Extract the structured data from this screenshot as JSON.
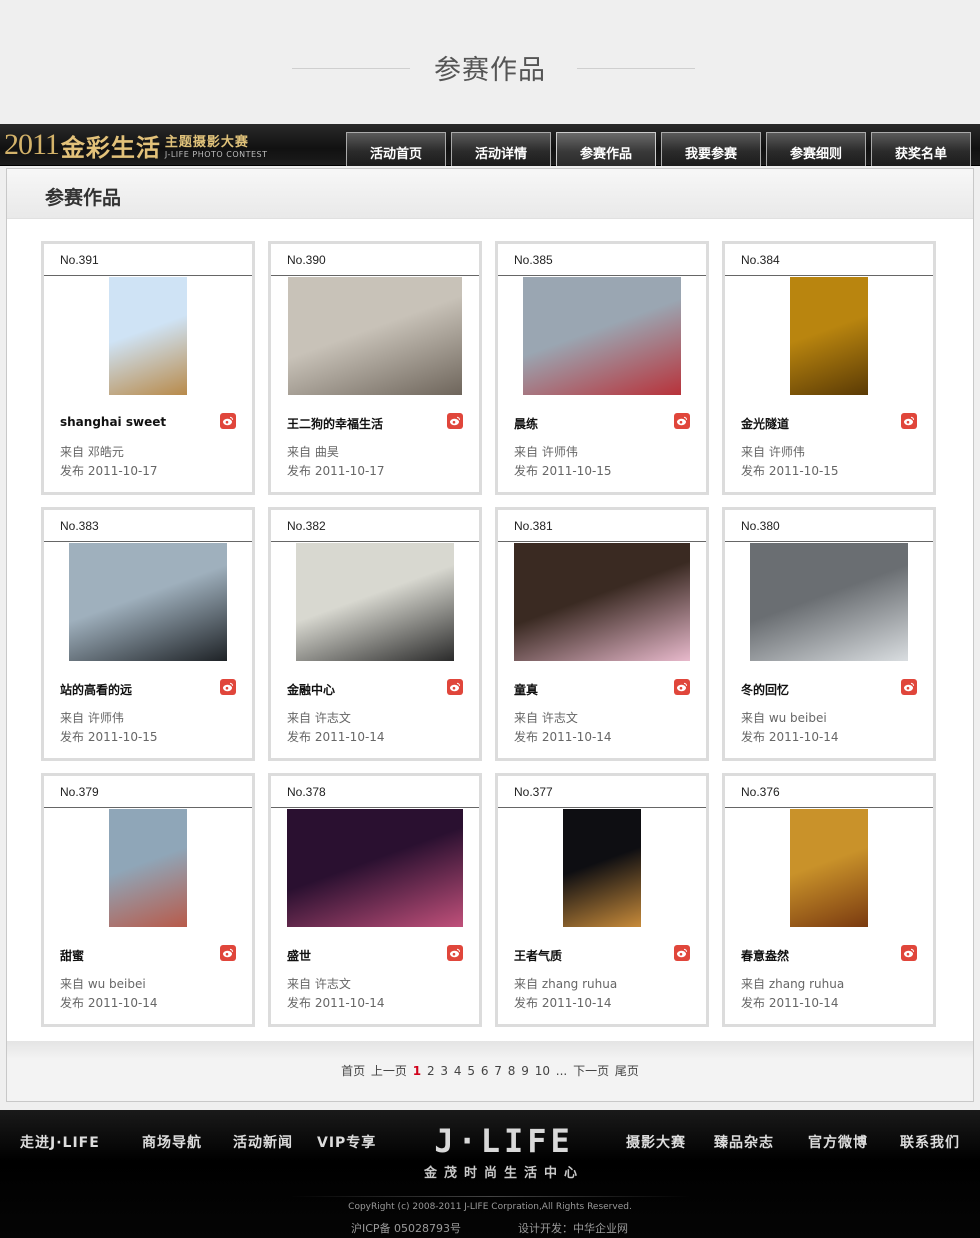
{
  "page": {
    "heading": "参赛作品"
  },
  "header": {
    "logo": {
      "year": "2011",
      "title": "金彩生活",
      "subtitle": "主题摄影大赛",
      "subtitle_en": "J-LIFE PHOTO CONTEST"
    },
    "nav": [
      {
        "label": "活动首页",
        "active": false
      },
      {
        "label": "活动详情",
        "active": false
      },
      {
        "label": "参赛作品",
        "active": true
      },
      {
        "label": "我要参赛",
        "active": false
      },
      {
        "label": "参赛细则",
        "active": false
      },
      {
        "label": "获奖名单",
        "active": false
      }
    ]
  },
  "panel": {
    "title": "参赛作品"
  },
  "entries": [
    {
      "no": "No.391",
      "title": "shanghai sweet",
      "from": "来自 邓皓元",
      "date": "发布 2011-10-17",
      "image": "portrait"
    },
    {
      "no": "No.390",
      "title": "王二狗的幸福生活",
      "from": "来自 曲昊",
      "date": "发布 2011-10-17",
      "image": "comic"
    },
    {
      "no": "No.385",
      "title": "晨练",
      "from": "来自 许师伟",
      "date": "发布 2011-10-15",
      "image": "wide"
    },
    {
      "no": "No.384",
      "title": "金光隧道",
      "from": "来自 许师伟",
      "date": "发布 2011-10-15",
      "image": "portrait"
    },
    {
      "no": "No.383",
      "title": "站的高看的远",
      "from": "来自 许师伟",
      "date": "发布 2011-10-15",
      "image": "wide"
    },
    {
      "no": "No.382",
      "title": "金融中心",
      "from": "来自 许志文",
      "date": "发布 2011-10-14",
      "image": "wide"
    },
    {
      "no": "No.381",
      "title": "童真",
      "from": "来自 许志文",
      "date": "发布 2011-10-14",
      "image": "wider"
    },
    {
      "no": "No.380",
      "title": "冬的回忆",
      "from": "来自 wu beibei",
      "date": "发布 2011-10-14",
      "image": "wide"
    },
    {
      "no": "No.379",
      "title": "甜蜜",
      "from": "来自 wu beibei",
      "date": "发布 2011-10-14",
      "image": "portrait"
    },
    {
      "no": "No.378",
      "title": "盛世",
      "from": "来自 许志文",
      "date": "发布 2011-10-14",
      "image": "wider"
    },
    {
      "no": "No.377",
      "title": "王者气质",
      "from": "来自 zhang ruhua",
      "date": "发布 2011-10-14",
      "image": "portrait"
    },
    {
      "no": "No.376",
      "title": "春意盎然",
      "from": "来自 zhang ruhua",
      "date": "发布 2011-10-14",
      "image": "portrait"
    }
  ],
  "pagination": {
    "first": "首页",
    "prev": "上一页",
    "pages": [
      "1",
      "2",
      "3",
      "4",
      "5",
      "6",
      "7",
      "8",
      "9",
      "10"
    ],
    "current": "1",
    "ellipsis": "...",
    "next": "下一页",
    "last": "尾页"
  },
  "footer": {
    "nav_left": [
      "走进J·LIFE",
      "商场导航",
      "活动新闻",
      "VIP专享"
    ],
    "nav_right": [
      "摄影大赛",
      "臻品杂志",
      "官方微博",
      "联系我们"
    ],
    "brand": "J·LIFE",
    "brand_tagline": "金茂时尚生活中心",
    "copyright": "CopyRight (c) 2008-2011 J-LIFE Corpration,All Rights Reserved.",
    "icp": "沪ICP备  05028793号",
    "developer": "设计开发：中华企业网"
  },
  "colors": {
    "accent_red": "#d0021b",
    "weibo": "#e0463b",
    "gold": "#d4b36a"
  }
}
